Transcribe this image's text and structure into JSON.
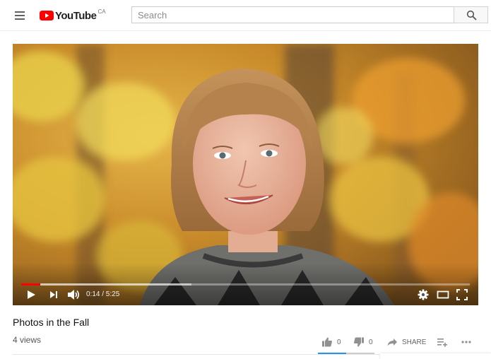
{
  "header": {
    "logo_text": "YouTube",
    "region": "CA",
    "search_placeholder": "Search"
  },
  "player": {
    "time_current": "0:14",
    "time_total": "5:25",
    "time_display": "0:14 / 5:25",
    "progress_played": 0.043,
    "progress_buffered": 0.38
  },
  "video": {
    "title": "Photos in the Fall",
    "views": "4 views"
  },
  "actions": {
    "likes": "0",
    "dislikes": "0",
    "share_label": "SHARE",
    "sentiment_ratio": 0.5
  },
  "colors": {
    "brand_red": "#ff0000",
    "like_bar": "#2793e6"
  },
  "icons": [
    "menu-icon",
    "youtube-logo",
    "search-icon",
    "play-icon",
    "next-icon",
    "volume-icon",
    "settings-icon",
    "theater-icon",
    "fullscreen-icon",
    "thumbs-up-icon",
    "thumbs-down-icon",
    "share-icon",
    "add-to-playlist-icon",
    "more-icon"
  ]
}
